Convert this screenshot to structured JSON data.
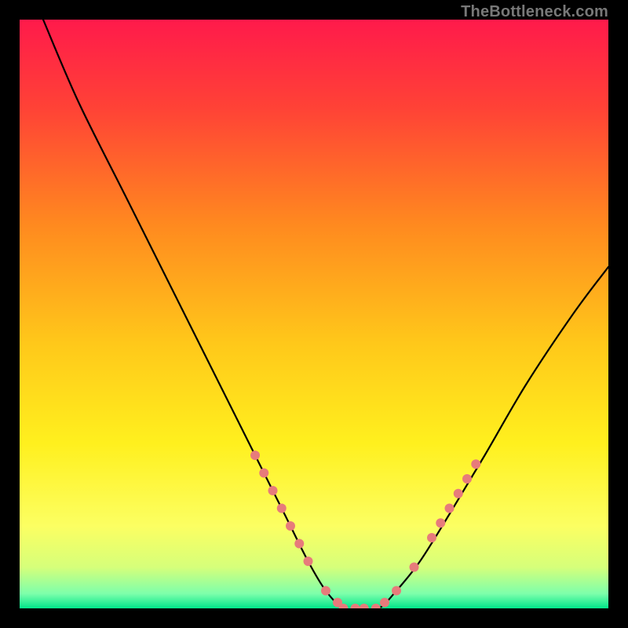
{
  "watermark": "TheBottleneck.com",
  "chart_data": {
    "type": "line",
    "title": "",
    "xlabel": "",
    "ylabel": "",
    "xlim": [
      0,
      100
    ],
    "ylim": [
      0,
      100
    ],
    "grid": false,
    "legend": false,
    "gradient_stops": [
      {
        "offset": 0.0,
        "color": "#ff1a4b"
      },
      {
        "offset": 0.15,
        "color": "#ff4236"
      },
      {
        "offset": 0.35,
        "color": "#ff8a1f"
      },
      {
        "offset": 0.55,
        "color": "#ffc81a"
      },
      {
        "offset": 0.72,
        "color": "#fff01e"
      },
      {
        "offset": 0.86,
        "color": "#fcff62"
      },
      {
        "offset": 0.93,
        "color": "#d6ff7a"
      },
      {
        "offset": 0.975,
        "color": "#7dffab"
      },
      {
        "offset": 1.0,
        "color": "#00e58a"
      }
    ],
    "series": [
      {
        "name": "bottleneck-curve",
        "x": [
          4,
          10,
          18,
          26,
          34,
          40,
          45,
          49,
          52,
          55,
          58,
          61,
          64,
          68,
          73,
          79,
          86,
          94,
          100
        ],
        "y": [
          100,
          86,
          70,
          54,
          38,
          26,
          16,
          8,
          3,
          0,
          0,
          0,
          3,
          8,
          16,
          26,
          38,
          50,
          58
        ]
      }
    ],
    "marker_series": {
      "name": "highlight-dots",
      "color": "#e77b7b",
      "radius": 6,
      "points": [
        {
          "x": 40.0,
          "y": 26.0
        },
        {
          "x": 41.5,
          "y": 23.0
        },
        {
          "x": 43.0,
          "y": 20.0
        },
        {
          "x": 44.5,
          "y": 17.0
        },
        {
          "x": 46.0,
          "y": 14.0
        },
        {
          "x": 47.5,
          "y": 11.0
        },
        {
          "x": 49.0,
          "y": 8.0
        },
        {
          "x": 52.0,
          "y": 3.0
        },
        {
          "x": 54.0,
          "y": 1.0
        },
        {
          "x": 55.0,
          "y": 0.0
        },
        {
          "x": 57.0,
          "y": 0.0
        },
        {
          "x": 58.5,
          "y": 0.0
        },
        {
          "x": 60.5,
          "y": 0.0
        },
        {
          "x": 62.0,
          "y": 1.0
        },
        {
          "x": 64.0,
          "y": 3.0
        },
        {
          "x": 67.0,
          "y": 7.0
        },
        {
          "x": 70.0,
          "y": 12.0
        },
        {
          "x": 71.5,
          "y": 14.5
        },
        {
          "x": 73.0,
          "y": 17.0
        },
        {
          "x": 74.5,
          "y": 19.5
        },
        {
          "x": 76.0,
          "y": 22.0
        },
        {
          "x": 77.5,
          "y": 24.5
        }
      ]
    }
  }
}
